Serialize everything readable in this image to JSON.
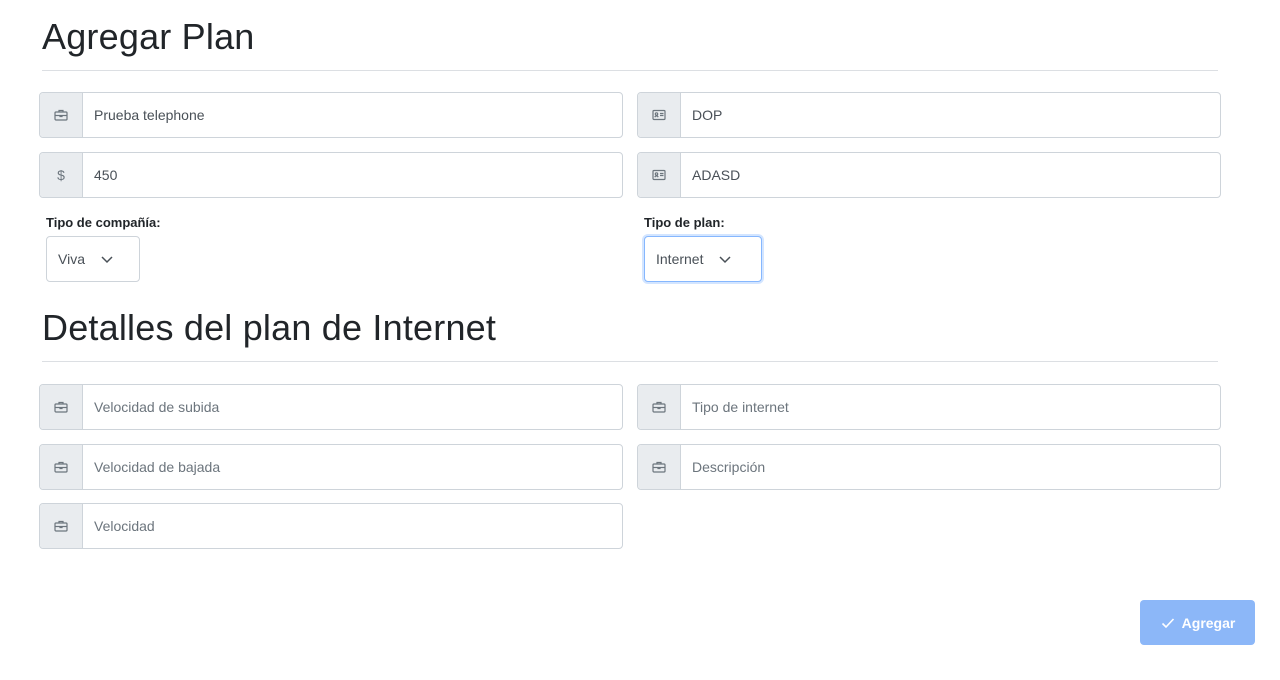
{
  "header": {
    "title": "Agregar Plan"
  },
  "plan_fields": {
    "name": {
      "value": "Prueba telephone",
      "icon": "briefcase-icon"
    },
    "currency": {
      "value": "DOP",
      "icon": "id-card-icon"
    },
    "price": {
      "value": "450",
      "icon": "dollar-icon",
      "symbol": "$"
    },
    "code": {
      "value": "ADASD",
      "icon": "id-card-icon"
    }
  },
  "company": {
    "label": "Tipo de compañía:",
    "selected": "Viva"
  },
  "plan_type": {
    "label": "Tipo de plan:",
    "selected": "Internet"
  },
  "details": {
    "title": "Detalles del plan de Internet",
    "upload_speed": {
      "placeholder": "Velocidad de subida"
    },
    "internet_type": {
      "placeholder": "Tipo de internet"
    },
    "download_speed": {
      "placeholder": "Velocidad de bajada"
    },
    "description": {
      "placeholder": "Descripción"
    },
    "speed": {
      "placeholder": "Velocidad"
    }
  },
  "actions": {
    "submit_label": "Agregar"
  },
  "colors": {
    "accent": "#8cb7f8",
    "addon_bg": "#e9ecef",
    "border": "#ced4da"
  }
}
